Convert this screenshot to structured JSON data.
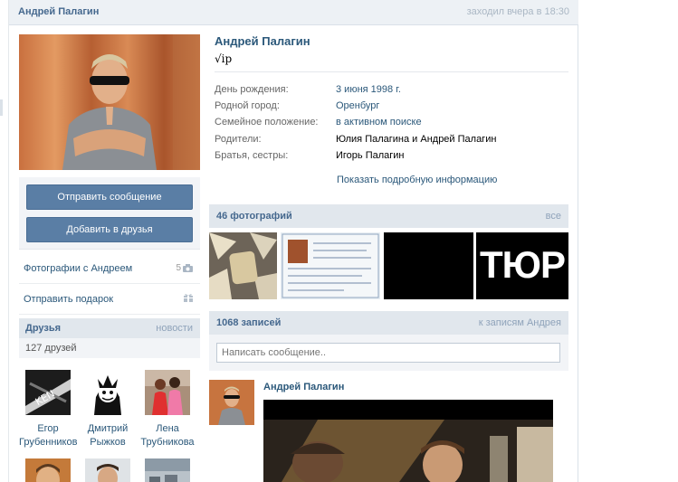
{
  "topbar": {
    "name": "Андрей Палагин",
    "last_seen": "заходил вчера в 18:30"
  },
  "profile": {
    "name": "Андрей Палагин",
    "status": "√ip",
    "info": [
      {
        "label": "День рождения:",
        "value": "3 июня 1998 г.",
        "link": true
      },
      {
        "label": "Родной город:",
        "value": "Оренбург",
        "link": true
      },
      {
        "label": "Семейное положение:",
        "value": "в активном поиске",
        "link": true
      },
      {
        "label": "Родители:",
        "value": "Юлия Палагина и Андрей Палагин",
        "link": false
      },
      {
        "label": "Братья, сестры:",
        "value": "Игорь Палагин",
        "link": false
      }
    ],
    "more_label": "Показать подробную информацию"
  },
  "actions": {
    "send_message": "Отправить сообщение",
    "add_friend": "Добавить в друзья"
  },
  "side": {
    "photos_with": "Фотографии с Андреем",
    "photos_with_count": "5",
    "send_gift": "Отправить подарок"
  },
  "friends": {
    "title": "Друзья",
    "link": "новости",
    "count": "127 друзей",
    "items": [
      {
        "first": "Егор",
        "last": "Грубенников"
      },
      {
        "first": "Дмитрий",
        "last": "Рыжков"
      },
      {
        "first": "Лена",
        "last": "Трубникова"
      }
    ]
  },
  "photos": {
    "title": "46 фотографий",
    "link": "все",
    "tile4_text": "ТЮР"
  },
  "wall": {
    "title": "1068 записей",
    "link": "к записям Андрея",
    "placeholder": "Написать сообщение..",
    "post_author": "Андрей Палагин"
  },
  "colors": {
    "link": "#2b587a",
    "header_bg": "#e1e7ed",
    "button": "#5a7ea5"
  }
}
